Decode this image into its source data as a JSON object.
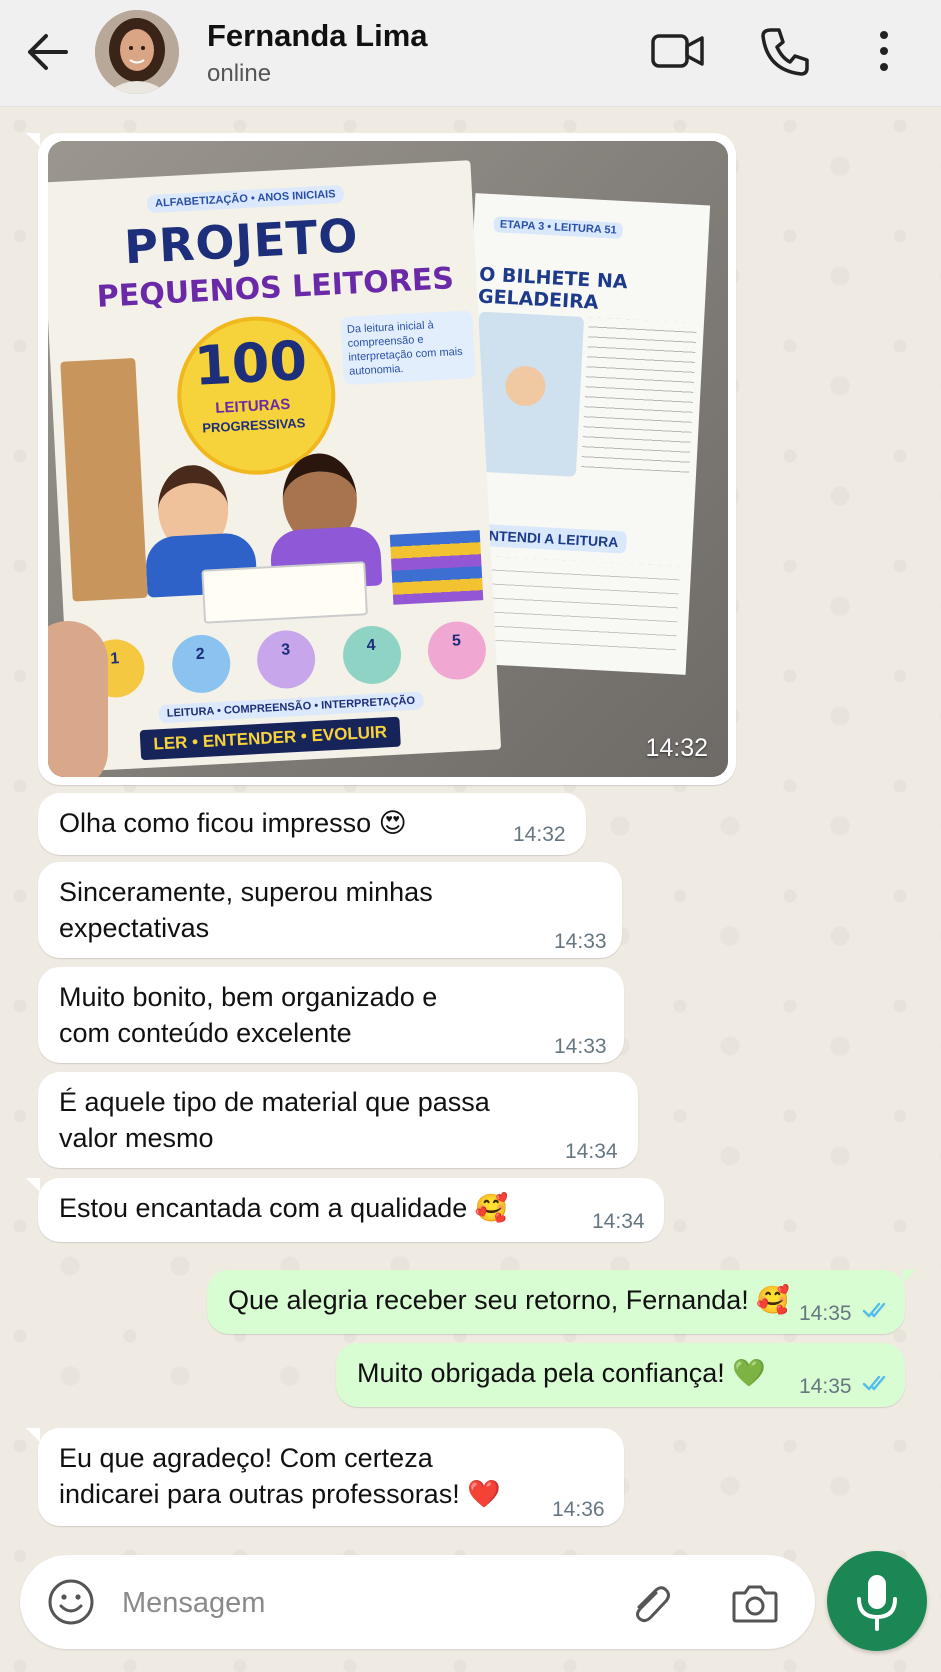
{
  "header": {
    "contact_name": "Fernanda Lima",
    "status": "online"
  },
  "colors": {
    "header_bg": "#f0f0f0",
    "incoming_bubble": "#ffffff",
    "outgoing_bubble": "#d9fdd3",
    "read_ticks": "#53bdeb",
    "mic_button": "#1a8754",
    "wallpaper": "#efeae2"
  },
  "image_message": {
    "time": "14:32",
    "cover": {
      "top_label": "ALFABETIZAÇÃO • ANOS INICIAIS",
      "title_line1": "PROJETO",
      "title_line2": "PEQUENOS LEITORES",
      "big_number": "100",
      "subtitle_line1": "LEITURAS",
      "subtitle_line2": "PROGRESSIVAS",
      "side_note": "Da leitura inicial à compreensão e interpretação com mais autonomia.",
      "footer_band": "LEITURA • COMPREENSÃO • INTERPRETAÇÃO",
      "footer_slogan": "LER • ENTENDER • EVOLUIR",
      "steps": [
        "1",
        "2",
        "3",
        "4",
        "5"
      ]
    },
    "worksheet": {
      "stage": "ETAPA 3 • LEITURA 51",
      "title": "O BILHETE NA GELADEIRA",
      "section": "ENTENDI A LEITURA"
    }
  },
  "messages": [
    {
      "direction": "in",
      "text": "Olha como ficou impresso 😍",
      "time": "14:32"
    },
    {
      "direction": "in",
      "text_lines": [
        "Sinceramente, superou minhas",
        "expectativas"
      ],
      "time": "14:33"
    },
    {
      "direction": "in",
      "text_lines": [
        "Muito bonito, bem organizado e",
        "com conteúdo excelente"
      ],
      "time": "14:33"
    },
    {
      "direction": "in",
      "text_lines": [
        "É aquele tipo de material que passa",
        "valor mesmo"
      ],
      "time": "14:34"
    },
    {
      "direction": "in",
      "text": "Estou encantada com a qualidade 🥰",
      "time": "14:34"
    },
    {
      "direction": "out",
      "text": "Que alegria receber seu retorno, Fernanda! 🥰",
      "time": "14:35",
      "status": "read"
    },
    {
      "direction": "out",
      "text": "Muito obrigada pela confiança! 💚",
      "time": "14:35",
      "status": "read"
    },
    {
      "direction": "in",
      "text_lines": [
        "Eu que agradeço! Com certeza",
        "indicarei para outras professoras! ❤️"
      ],
      "time": "14:36"
    }
  ],
  "composer": {
    "placeholder": "Mensagem"
  },
  "icons": {
    "back": "arrow-left-icon",
    "video": "video-camera-icon",
    "call": "phone-icon",
    "menu": "more-vertical-icon",
    "emoji": "smiley-icon",
    "attach": "paperclip-icon",
    "camera": "camera-icon",
    "mic": "microphone-icon"
  }
}
